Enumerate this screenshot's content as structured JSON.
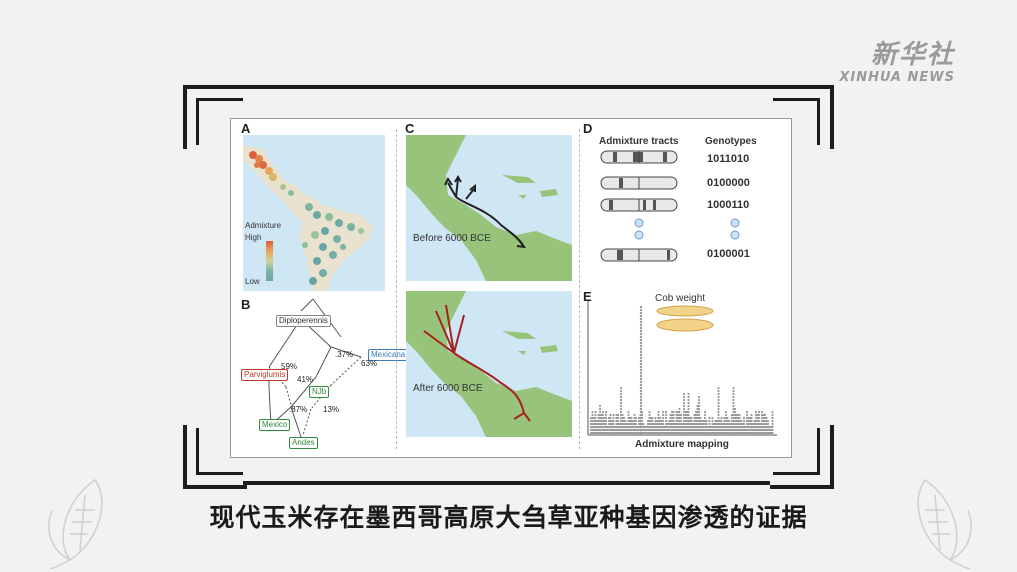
{
  "logo": {
    "cn": "新华社",
    "en": "XINHUA NEWS"
  },
  "caption": "现代玉米存在墨西哥高原大刍草亚种基因渗透的证据",
  "panels": {
    "A": {
      "label": "A",
      "legend_title": "Admixture",
      "legend_high": "High",
      "legend_low": "Low"
    },
    "B": {
      "label": "B",
      "nodes": {
        "diploperennis": "Diploperennis",
        "mexicana": "Mexicana",
        "parviglumis": "Parviglumis",
        "njb": "NJb",
        "mexico": "Mexico",
        "andes": "Andes"
      },
      "percents": {
        "p59": "59%",
        "p37": ".37%",
        "p63": "63%",
        "p41": "41%",
        "p87": ".87%",
        "p13": "13%"
      }
    },
    "C": {
      "label": "C",
      "before": "Before 6000 BCE",
      "after": "After 6000 BCE"
    },
    "D": {
      "label": "D",
      "col_tracts": "Admixture tracts",
      "col_genotypes": "Genotypes",
      "genotypes": [
        "1011010",
        "0100000",
        "1000110",
        "0100001"
      ]
    },
    "E": {
      "label": "E",
      "title": "Cob weight",
      "xlabel": "Admixture mapping"
    }
  },
  "colors": {
    "ocean": "#cfe6f4",
    "land": "#98c37a",
    "arrow_before": "#222222",
    "arrow_after": "#a4231e"
  }
}
